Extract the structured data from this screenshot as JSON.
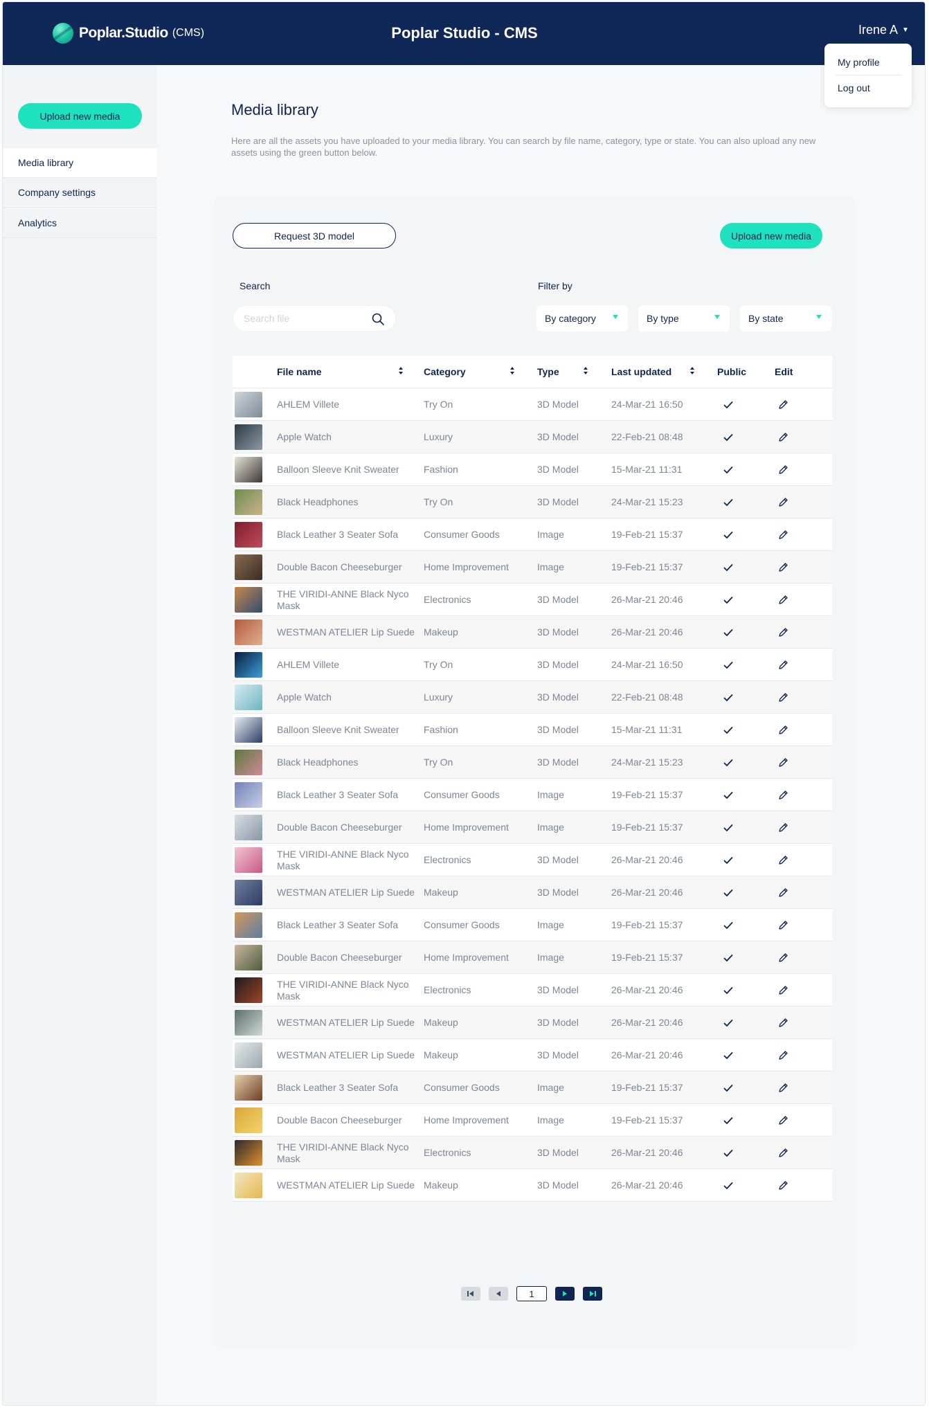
{
  "header": {
    "logo_text": "Poplar.Studio",
    "logo_sub": "(CMS)",
    "app_title": "Poplar Studio - CMS",
    "user_name": "Irene A",
    "user_menu": {
      "profile": "My profile",
      "logout": "Log out"
    }
  },
  "sidebar": {
    "upload_label": "Upload new media",
    "items": [
      {
        "label": "Media library",
        "active": true
      },
      {
        "label": "Company settings",
        "active": false
      },
      {
        "label": "Analytics",
        "active": false
      }
    ]
  },
  "main": {
    "title": "Media library",
    "description": "Here are all the assets you have uploaded to your media library. You can search by file name, category, type or state. You can also upload any new assets using the green button below.",
    "request_button": "Request 3D model",
    "upload_button": "Upload new media",
    "search_label": "Search",
    "search_placeholder": "Search file",
    "filter_label": "Filter by",
    "filters": {
      "category": "By category",
      "type": "By type",
      "state": "By state"
    }
  },
  "table": {
    "columns": {
      "name": "File name",
      "category": "Category",
      "type": "Type",
      "updated": "Last updated",
      "public": "Public",
      "edit": "Edit"
    },
    "rows": [
      {
        "name": "AHLEM Villete",
        "category": "Try On",
        "type": "3D Model",
        "updated": "24-Mar-21 16:50",
        "public": true
      },
      {
        "name": "Apple Watch",
        "category": "Luxury",
        "type": "3D Model",
        "updated": "22-Feb-21 08:48",
        "public": true
      },
      {
        "name": "Balloon Sleeve Knit Sweater",
        "category": "Fashion",
        "type": "3D Model",
        "updated": "15-Mar-21 11:31",
        "public": true
      },
      {
        "name": "Black Headphones",
        "category": "Try On",
        "type": "3D Model",
        "updated": "24-Mar-21 15:23",
        "public": true
      },
      {
        "name": "Black Leather 3 Seater Sofa",
        "category": "Consumer Goods",
        "type": "Image",
        "updated": "19-Feb-21 15:37",
        "public": true
      },
      {
        "name": "Double Bacon Cheeseburger",
        "category": "Home Improvement",
        "type": "Image",
        "updated": "19-Feb-21 15:37",
        "public": true
      },
      {
        "name": "THE VIRIDI-ANNE Black Nyco Mask",
        "category": "Electronics",
        "type": "3D Model",
        "updated": "26-Mar-21 20:46",
        "public": true
      },
      {
        "name": "WESTMAN ATELIER Lip Suede",
        "category": "Makeup",
        "type": "3D Model",
        "updated": "26-Mar-21 20:46",
        "public": true
      },
      {
        "name": "AHLEM Villete",
        "category": "Try On",
        "type": "3D Model",
        "updated": "24-Mar-21 16:50",
        "public": true
      },
      {
        "name": "Apple Watch",
        "category": "Luxury",
        "type": "3D Model",
        "updated": "22-Feb-21 08:48",
        "public": true
      },
      {
        "name": "Balloon Sleeve Knit Sweater",
        "category": "Fashion",
        "type": "3D Model",
        "updated": "15-Mar-21 11:31",
        "public": true
      },
      {
        "name": "Black Headphones",
        "category": "Try On",
        "type": "3D Model",
        "updated": "24-Mar-21 15:23",
        "public": true
      },
      {
        "name": "Black Leather 3 Seater Sofa",
        "category": "Consumer Goods",
        "type": "Image",
        "updated": "19-Feb-21 15:37",
        "public": true
      },
      {
        "name": "Double Bacon Cheeseburger",
        "category": "Home Improvement",
        "type": "Image",
        "updated": "19-Feb-21 15:37",
        "public": true
      },
      {
        "name": "THE VIRIDI-ANNE Black Nyco Mask",
        "category": "Electronics",
        "type": "3D Model",
        "updated": "26-Mar-21 20:46",
        "public": true
      },
      {
        "name": "WESTMAN ATELIER Lip Suede",
        "category": "Makeup",
        "type": "3D Model",
        "updated": "26-Mar-21 20:46",
        "public": true
      },
      {
        "name": "Black Leather 3 Seater Sofa",
        "category": "Consumer Goods",
        "type": "Image",
        "updated": "19-Feb-21 15:37",
        "public": true
      },
      {
        "name": "Double Bacon Cheeseburger",
        "category": "Home Improvement",
        "type": "Image",
        "updated": "19-Feb-21 15:37",
        "public": true
      },
      {
        "name": "THE VIRIDI-ANNE Black Nyco Mask",
        "category": "Electronics",
        "type": "3D Model",
        "updated": "26-Mar-21 20:46",
        "public": true
      },
      {
        "name": "WESTMAN ATELIER Lip Suede",
        "category": "Makeup",
        "type": "3D Model",
        "updated": "26-Mar-21 20:46",
        "public": true
      },
      {
        "name": "WESTMAN ATELIER Lip Suede",
        "category": "Makeup",
        "type": "3D Model",
        "updated": "26-Mar-21 20:46",
        "public": true
      },
      {
        "name": "Black Leather 3 Seater Sofa",
        "category": "Consumer Goods",
        "type": "Image",
        "updated": "19-Feb-21 15:37",
        "public": true
      },
      {
        "name": "Double Bacon Cheeseburger",
        "category": "Home Improvement",
        "type": "Image",
        "updated": "19-Feb-21 15:37",
        "public": true
      },
      {
        "name": "THE VIRIDI-ANNE Black Nyco Mask",
        "category": "Electronics",
        "type": "3D Model",
        "updated": "26-Mar-21 20:46",
        "public": true
      },
      {
        "name": "WESTMAN ATELIER Lip Suede",
        "category": "Makeup",
        "type": "3D Model",
        "updated": "26-Mar-21 20:46",
        "public": true
      }
    ]
  },
  "pagination": {
    "current_page": "1"
  },
  "colors": {
    "navy": "#0f2858",
    "accent": "#1ee2bd",
    "text": "#0f2451",
    "muted": "#7c8694"
  }
}
